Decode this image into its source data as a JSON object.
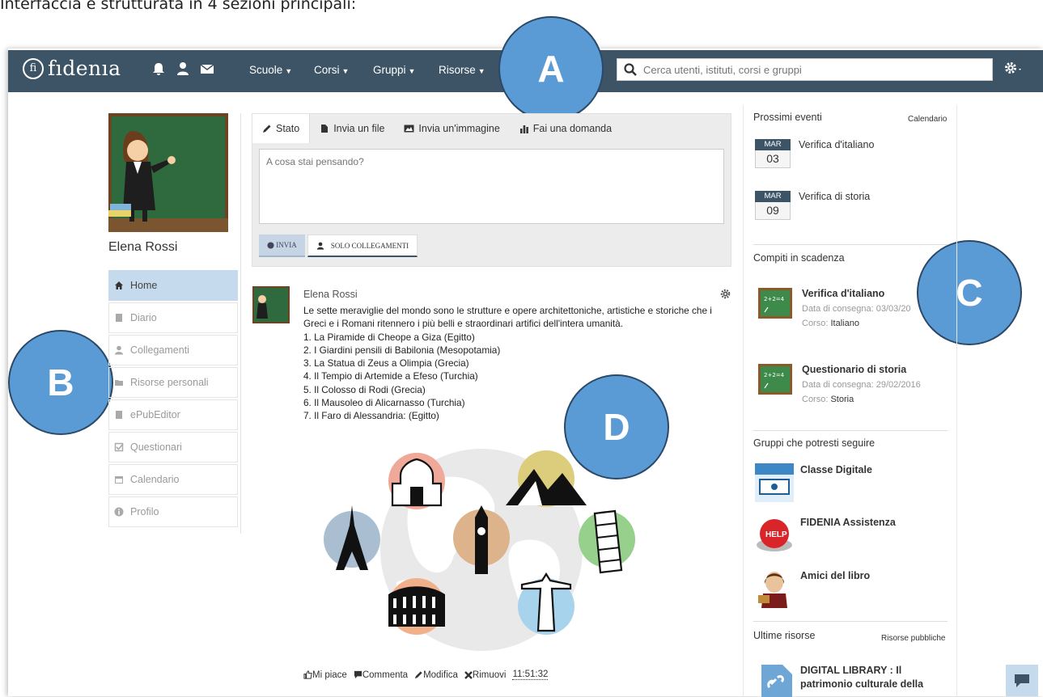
{
  "caption": "Interfaccia è strutturata in 4 sezioni principali:",
  "navbar": {
    "logo_mark": "fi",
    "logo_text": "fıdenıa",
    "menus": [
      {
        "label": "Scuole"
      },
      {
        "label": "Corsi"
      },
      {
        "label": "Gruppi"
      },
      {
        "label": "Risorse"
      }
    ],
    "search_placeholder": "Cerca utenti, istituti, corsi e gruppi"
  },
  "callouts": {
    "a": "A",
    "b": "B",
    "c": "C",
    "d": "D"
  },
  "profile": {
    "name": "Elena Rossi"
  },
  "sidebar": {
    "items": [
      {
        "label": "Home",
        "icon": "home-icon"
      },
      {
        "label": "Diario",
        "icon": "book-icon"
      },
      {
        "label": "Collegamenti",
        "icon": "user-icon"
      },
      {
        "label": "Risorse personali",
        "icon": "folder-icon"
      },
      {
        "label": "ePubEditor",
        "icon": "book-icon"
      },
      {
        "label": "Questionari",
        "icon": "checkbox-icon"
      },
      {
        "label": "Calendario",
        "icon": "calendar-icon"
      },
      {
        "label": "Profilo",
        "icon": "info-icon"
      }
    ]
  },
  "composer": {
    "tabs": [
      {
        "label": "Stato"
      },
      {
        "label": "Invia un file"
      },
      {
        "label": "Invia un'immagine"
      },
      {
        "label": "Fai una domanda"
      }
    ],
    "placeholder": "A cosa stai pensando?",
    "send_label": "INVIA",
    "visibility_label": "SOLO COLLEGAMENTI"
  },
  "feed": {
    "author": "Elena Rossi",
    "text": "Le sette meraviglie del mondo sono le strutture e opere architettoniche, artistiche e storiche che i Greci e i Romani ritennero i più belli e straordinari artifici dell'intera umanità.",
    "list": [
      "1. La Piramide di Cheope a Giza (Egitto)",
      "2. I Giardini pensili di Babilonia (Mesopotamia)",
      "3. La Statua di Zeus a Olimpia (Grecia)",
      "4. Il Tempio di Artemide a Efeso (Turchia)",
      "5. Il Colosso di Rodi (Grecia)",
      "6. Il Mausoleo di Alicarnasso (Turchia)",
      "7. Il Faro di Alessandria: (Egitto)"
    ],
    "actions": {
      "like": "Mi piace",
      "comment": "Commenta",
      "edit": "Modifica",
      "remove": "Rimuovi",
      "time": "11:51:32"
    }
  },
  "right": {
    "events_title": "Prossimi eventi",
    "events_link": "Calendario",
    "events": [
      {
        "month": "MAR",
        "day": "03",
        "title": "Verifica d'italiano"
      },
      {
        "month": "MAR",
        "day": "09",
        "title": "Verifica di storia"
      }
    ],
    "tasks_title": "Compiti in scadenza",
    "tasks": [
      {
        "title": "Verifica d'italiano",
        "due_label": "Data di consegna:",
        "due": "03/03/20",
        "course_label": "Corso:",
        "course": "Italiano"
      },
      {
        "title": "Questionario di storia",
        "due_label": "Data di consegna:",
        "due": "29/02/2016",
        "course_label": "Corso:",
        "course": "Storia"
      }
    ],
    "groups_title": "Gruppi che potresti seguire",
    "groups": [
      {
        "title": "Classe Digitale"
      },
      {
        "title": "FIDENIA Assistenza",
        "badge": "HELP"
      },
      {
        "title": "Amici del libro"
      }
    ],
    "resources_title": "Ultime risorse",
    "resources_link": "Risorse pubbliche",
    "resource": {
      "line1": "DIGITAL LIBRARY : Il",
      "line2": "patrimonio culturale della"
    }
  },
  "colors": {
    "navbar": "#3d5466",
    "active": "#c5dbed",
    "callout": "#5b9bd5"
  }
}
